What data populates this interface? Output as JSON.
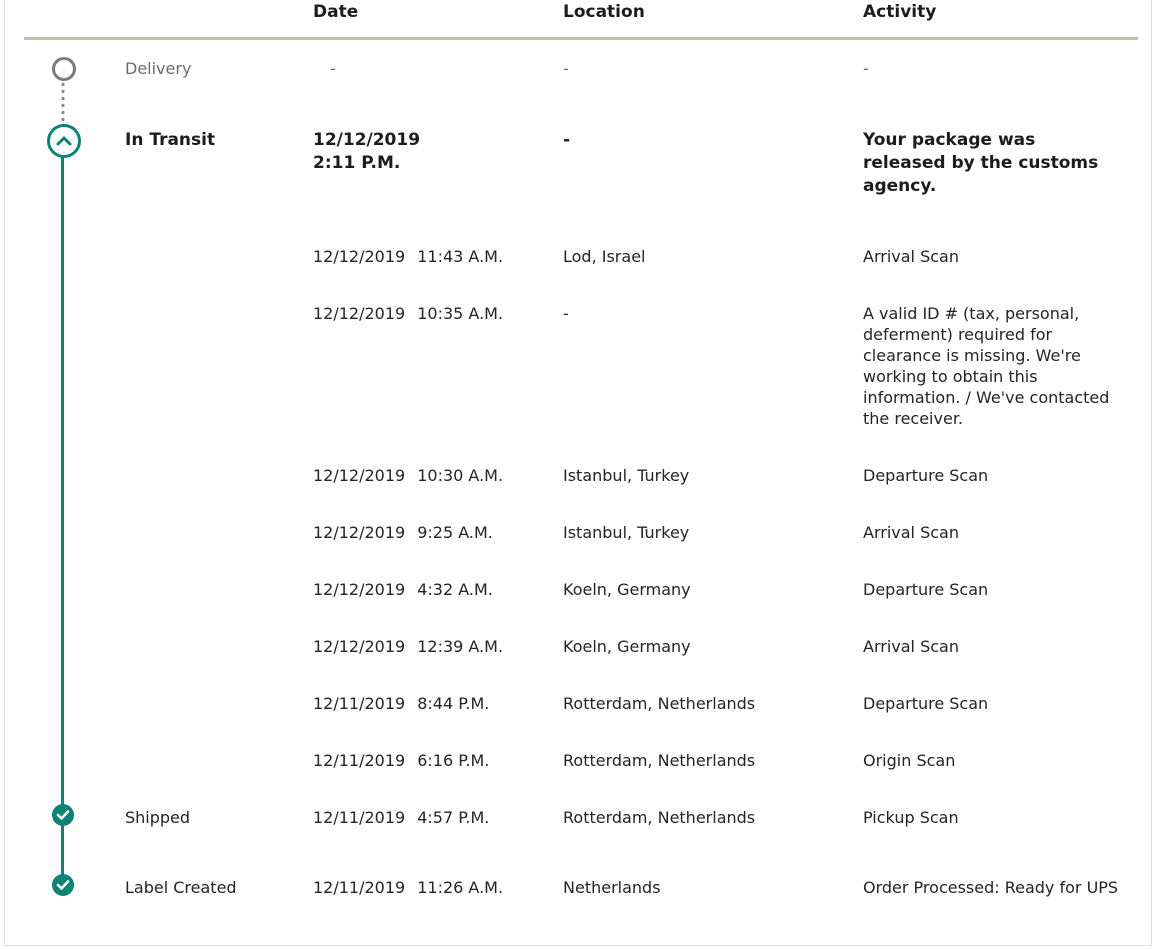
{
  "headers": {
    "date": "Date",
    "location": "Location",
    "activity": "Activity"
  },
  "milestones": {
    "delivery": {
      "label": "Delivery",
      "date": "-",
      "location": "-",
      "activity": "-"
    },
    "in_transit": {
      "label": "In Transit",
      "date_line1": "12/12/2019",
      "date_line2": "2:11 P.M.",
      "location": "-",
      "activity": "Your package was released by the customs agency."
    },
    "shipped": {
      "label": "Shipped"
    },
    "label_created": {
      "label": "Label Created"
    }
  },
  "events": [
    {
      "date": "12/12/2019",
      "time": "11:43 A.M.",
      "location": "Lod, Israel",
      "activity": "Arrival Scan"
    },
    {
      "date": "12/12/2019",
      "time": "10:35 A.M.",
      "location": "-",
      "activity": "A valid ID # (tax, personal, deferment) required for clearance is missing. We're working to obtain this information. / We've contacted the receiver."
    },
    {
      "date": "12/12/2019",
      "time": "10:30 A.M.",
      "location": "Istanbul, Turkey",
      "activity": "Departure Scan"
    },
    {
      "date": "12/12/2019",
      "time": "9:25 A.M.",
      "location": "Istanbul, Turkey",
      "activity": "Arrival Scan"
    },
    {
      "date": "12/12/2019",
      "time": "4:32 A.M.",
      "location": "Koeln, Germany",
      "activity": "Departure Scan"
    },
    {
      "date": "12/12/2019",
      "time": "12:39 A.M.",
      "location": "Koeln, Germany",
      "activity": "Arrival Scan"
    },
    {
      "date": "12/11/2019",
      "time": "8:44 P.M.",
      "location": "Rotterdam, Netherlands",
      "activity": "Departure Scan"
    },
    {
      "date": "12/11/2019",
      "time": "6:16 P.M.",
      "location": "Rotterdam, Netherlands",
      "activity": "Origin Scan"
    },
    {
      "date": "12/11/2019",
      "time": "4:57 P.M.",
      "location": "Rotterdam, Netherlands",
      "activity": "Pickup Scan"
    },
    {
      "date": "12/11/2019",
      "time": "11:26 A.M.",
      "location": "Netherlands",
      "activity": "Order Processed: Ready for UPS"
    }
  ],
  "colors": {
    "accent": "#0c8374",
    "divider": "#c6bfad",
    "muted": "#6b6b6b"
  }
}
